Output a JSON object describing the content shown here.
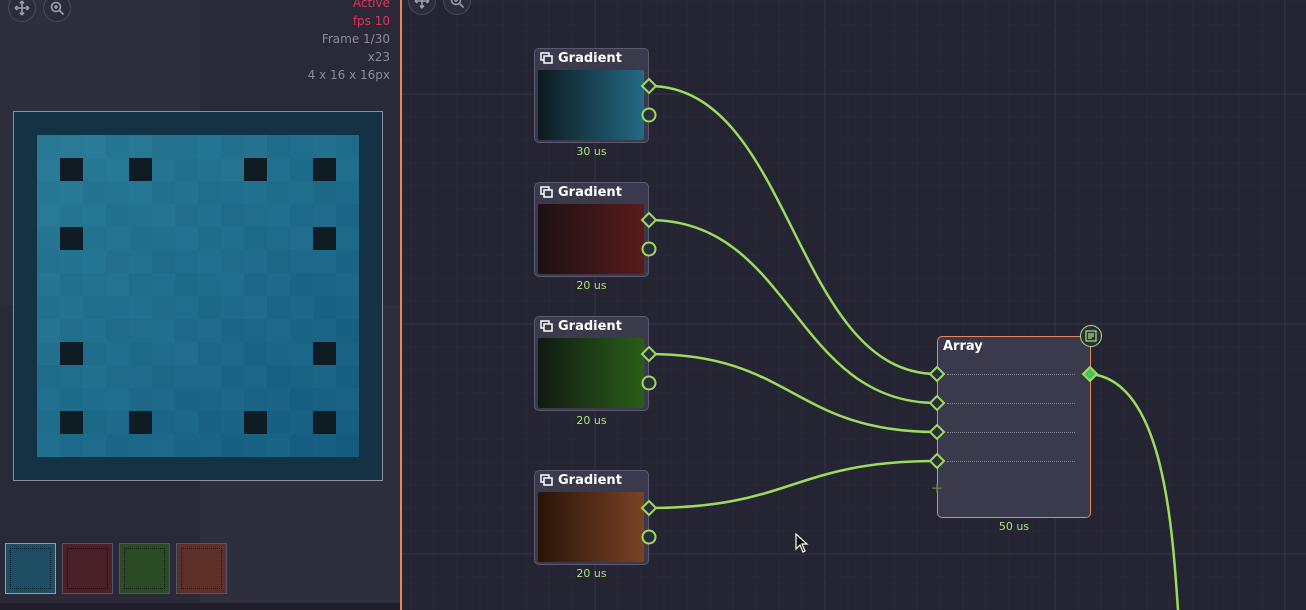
{
  "preview": {
    "status_text": "Active",
    "fps_text": "fps 10",
    "frame_text": "Frame 1/30",
    "zoom_text": "x23",
    "size_text": "4 x 16 x 16px",
    "move_icon": "move-icon",
    "zoom_icon": "zoom-icon",
    "thumb_colors": [
      "#1d4e63",
      "#4a2028",
      "#2a4a25",
      "#5a3028"
    ]
  },
  "graph": {
    "move_icon": "move-icon",
    "zoom_icon": "zoom-icon",
    "wire_color": "#9bdc5e",
    "nodes": [
      {
        "title": "Gradient",
        "timing": "30 us",
        "color_from": "#0d1a1f",
        "color_to": "#236a85"
      },
      {
        "title": "Gradient",
        "timing": "20 us",
        "color_from": "#1c1114",
        "color_to": "#5a1a1a"
      },
      {
        "title": "Gradient",
        "timing": "20 us",
        "color_from": "#111a12",
        "color_to": "#2a5e18"
      },
      {
        "title": "Gradient",
        "timing": "20 us",
        "color_from": "#2a1408",
        "color_to": "#7a4224"
      }
    ],
    "array_node": {
      "title": "Array",
      "timing": "50 us",
      "add_label": "+"
    }
  }
}
